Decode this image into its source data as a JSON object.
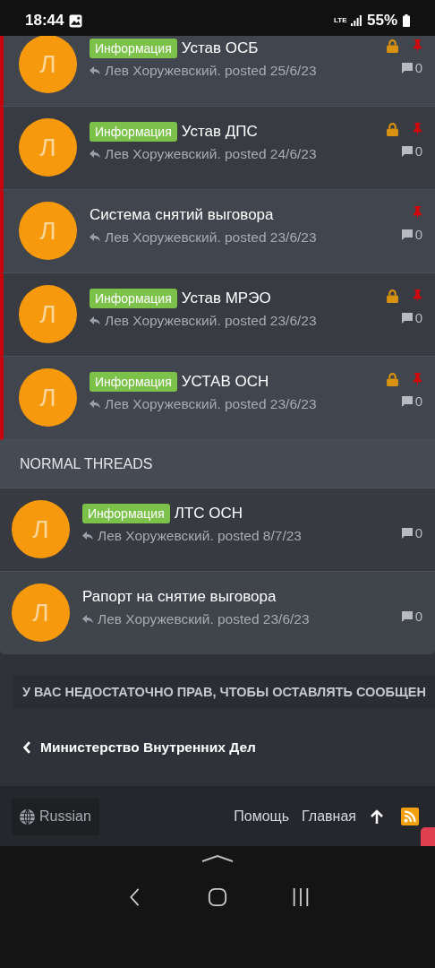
{
  "status_bar": {
    "time": "18:44",
    "network": "LTE",
    "battery": "55%"
  },
  "sticky_threads": [
    {
      "avatar": "Л",
      "prefix": "Информация",
      "title": "Устав ОСБ",
      "meta": "Лев Хоружевский. posted 25/6/23",
      "locked": true,
      "pinned": true,
      "replies": "0"
    },
    {
      "avatar": "Л",
      "prefix": "Информация",
      "title": "Устав ДПС",
      "meta": "Лев Хоружевский. posted 24/6/23",
      "locked": true,
      "pinned": true,
      "replies": "0"
    },
    {
      "avatar": "Л",
      "title": "Система снятий выговора",
      "meta": "Лев Хоружевский. posted 23/6/23",
      "locked": false,
      "pinned": true,
      "replies": "0"
    },
    {
      "avatar": "Л",
      "prefix": "Информация",
      "title": "Устав МРЭО",
      "meta": "Лев Хоружевский. posted 23/6/23",
      "locked": true,
      "pinned": true,
      "replies": "0"
    },
    {
      "avatar": "Л",
      "prefix": "Информация",
      "title": "УСТАВ ОСН",
      "meta": "Лев Хоружевский. posted 23/6/23",
      "locked": true,
      "pinned": true,
      "replies": "0"
    }
  ],
  "normal_header": "NORMAL THREADS",
  "normal_threads": [
    {
      "avatar": "Л",
      "prefix": "Информация",
      "title": "ЛТС ОСН",
      "meta": "Лев Хоружевский. posted 8/7/23",
      "locked": false,
      "pinned": false,
      "replies": "0"
    },
    {
      "avatar": "Л",
      "title": "Рапорт на снятие выговора",
      "meta": "Лев Хоружевский. posted 23/6/23",
      "locked": false,
      "pinned": false,
      "replies": "0"
    }
  ],
  "notice": "У ВАС НЕДОСТАТОЧНО ПРАВ, ЧТОБЫ ОСТАВЛЯТЬ СООБЩЕН",
  "breadcrumb": "Министерство Внутренних Дел",
  "footer": {
    "language": "Russian",
    "links": [
      "Помощь",
      "Главная"
    ]
  }
}
